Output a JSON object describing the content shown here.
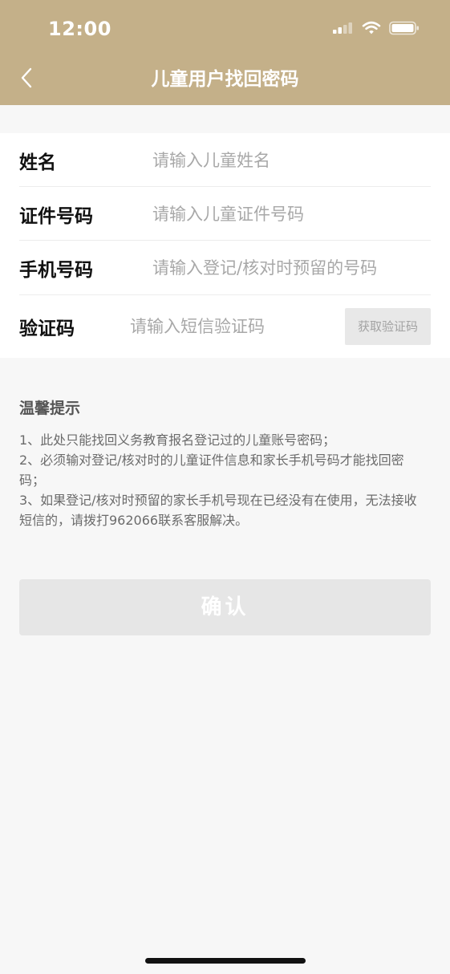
{
  "status_bar": {
    "time": "12:00",
    "icons": [
      "cellular-signal-icon",
      "wifi-icon",
      "battery-icon"
    ]
  },
  "nav": {
    "back_icon": "chevron-left-icon",
    "title": "儿童用户找回密码"
  },
  "form": {
    "name": {
      "label": "姓名",
      "placeholder": "请输入儿童姓名",
      "value": ""
    },
    "id_number": {
      "label": "证件号码",
      "placeholder": "请输入儿童证件号码",
      "value": ""
    },
    "phone": {
      "label": "手机号码",
      "placeholder": "请输入登记/核对时预留的号码",
      "value": ""
    },
    "code": {
      "label": "验证码",
      "placeholder": "请输入短信验证码",
      "value": "",
      "button_label": "获取验证码"
    }
  },
  "tips": {
    "title": "温馨提示",
    "items": [
      "1、此处只能找回义务教育报名登记过的儿童账号密码；",
      "2、必须输对登记/核对时的儿童证件信息和家长手机号码才能找回密码；",
      "3、如果登记/核对时预留的家长手机号现在已经没有在使用，无法接收短信的，请拨打962066联系客服解决。"
    ]
  },
  "confirm_label": "确认",
  "colors": {
    "header_bg": "#c4b089",
    "page_bg": "#f7f7f7",
    "disabled_button_bg": "#e6e6e6"
  }
}
